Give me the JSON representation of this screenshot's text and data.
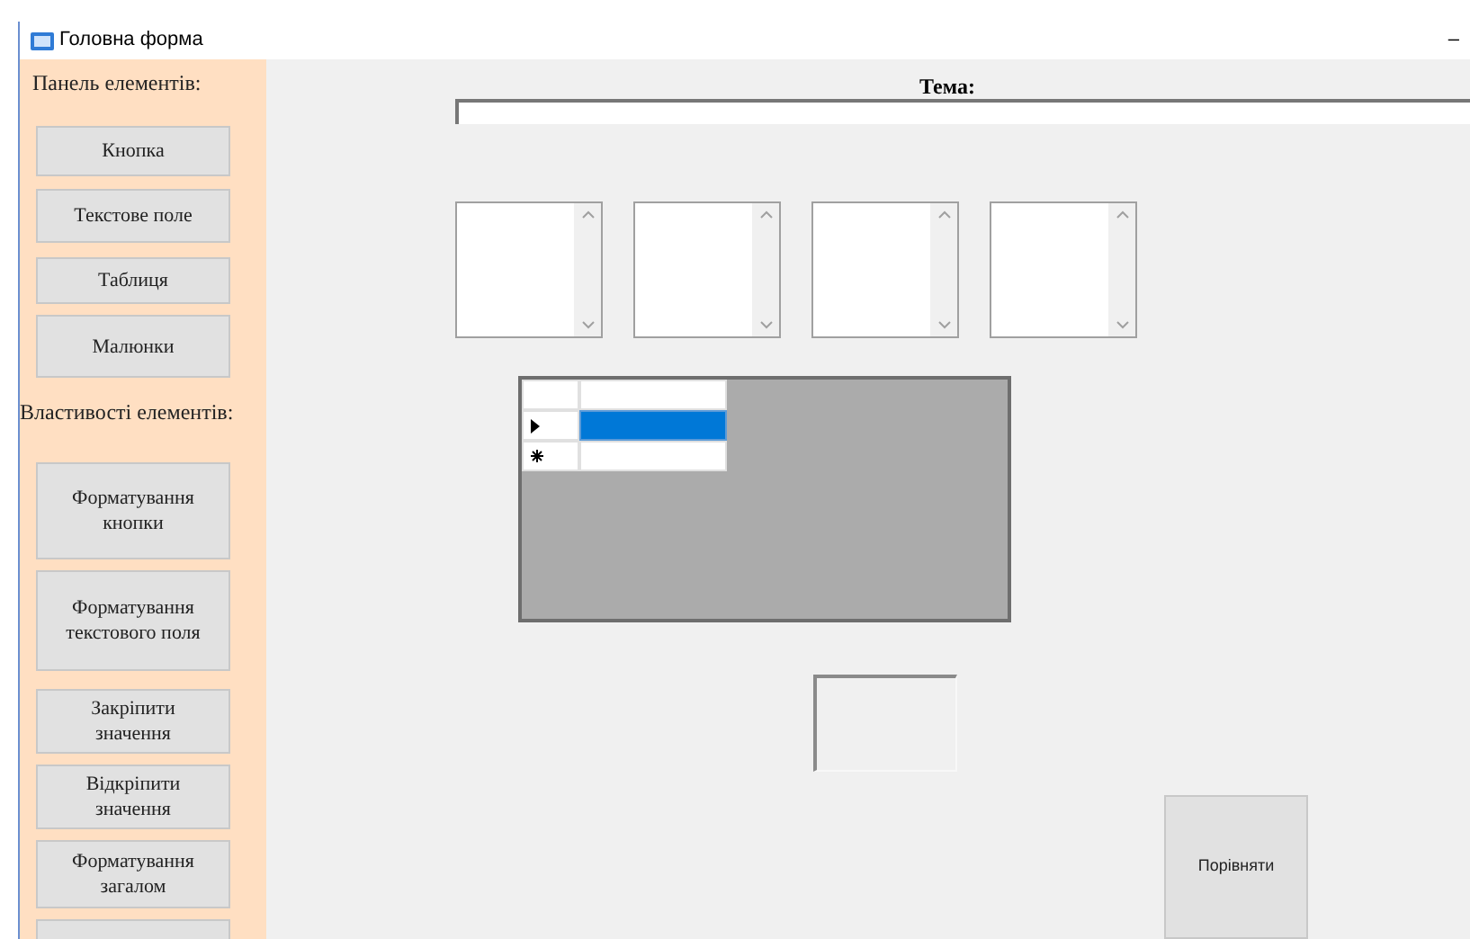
{
  "window": {
    "title": "Головна форма",
    "minimize": "–"
  },
  "sidebar": {
    "sections": [
      {
        "label": "Панель елементів:",
        "buttons": [
          "Кнопка",
          "Текстове поле",
          "Таблиця",
          "Малюнки"
        ]
      },
      {
        "label": "Властивості елементів:",
        "buttons": [
          "Форматування кнопки",
          "Форматування текстового поля",
          "Закріпити значення",
          "Відкріпити значення",
          "Форматування загалом"
        ]
      }
    ]
  },
  "topic": {
    "label": "Тема:"
  },
  "list_boxes": [
    {
      "kind": "scrollable"
    },
    {
      "kind": "scrollable"
    },
    {
      "kind": "scrollable"
    },
    {
      "kind": "scrollable"
    }
  ],
  "grid": {
    "rows": [
      {
        "kind": "current",
        "selected": true
      },
      {
        "kind": "new",
        "selected": false
      }
    ]
  },
  "compare_button": "Порівняти"
}
